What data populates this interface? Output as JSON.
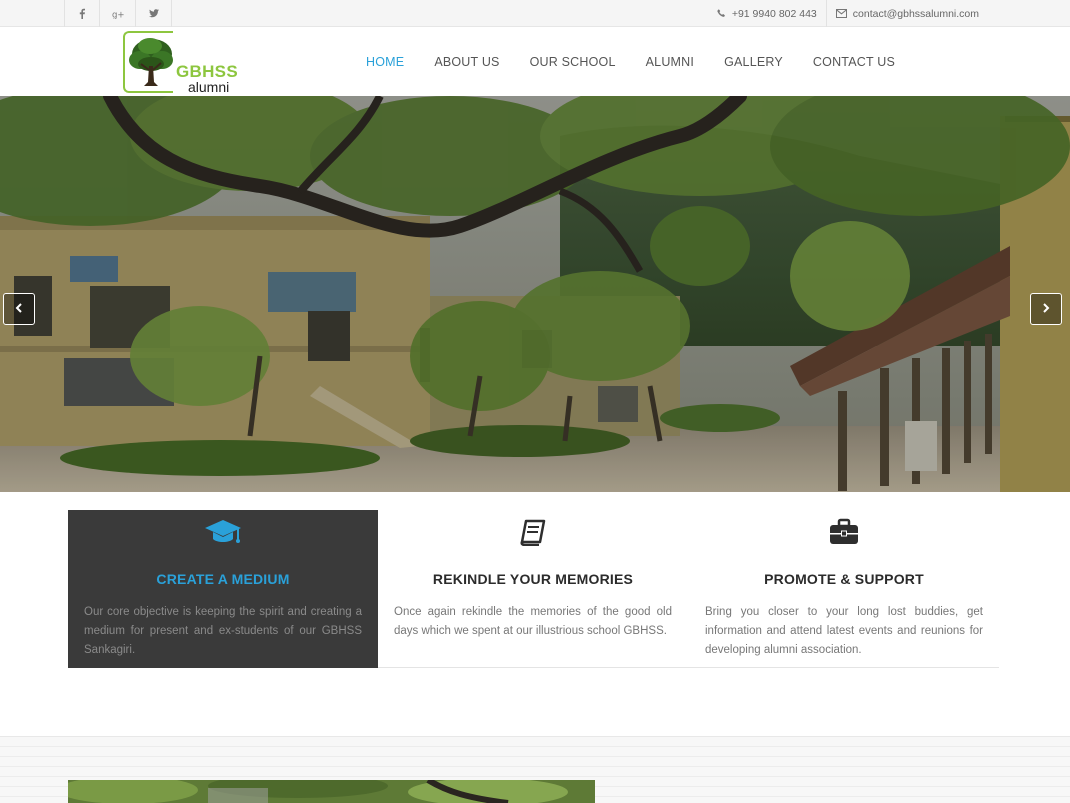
{
  "topbar": {
    "social": [
      {
        "name": "facebook-icon",
        "glyph": "f"
      },
      {
        "name": "google-plus-icon",
        "glyph": "g+"
      },
      {
        "name": "twitter-icon",
        "glyph": "t"
      }
    ],
    "phone": "+91 9940 802 443",
    "email": "contact@gbhssalumni.com"
  },
  "logo": {
    "title": "GBHSS",
    "subtitle": "alumni"
  },
  "nav": {
    "items": [
      "HOME",
      "ABOUT US",
      "OUR SCHOOL",
      "ALUMNI",
      "GALLERY",
      "CONTACT US"
    ],
    "active": "HOME"
  },
  "features": [
    {
      "icon": "graduation-cap-icon",
      "title": "CREATE A MEDIUM",
      "text": "Our core objective is keeping the spirit and creating a medium for present and ex-students of our GBHSS Sankagiri."
    },
    {
      "icon": "book-icon",
      "title": "REKINDLE YOUR MEMORIES",
      "text": "Once again rekindle the memories of the good old days which we spent at our illustrious school GBHSS."
    },
    {
      "icon": "briefcase-icon",
      "title": "PROMOTE & SUPPORT",
      "text": "Bring you closer to your long lost buddies, get information and attend latest events and reunions for developing alumni association."
    }
  ],
  "colors": {
    "accent": "#2aa1d9",
    "logo_green": "#8dc63f",
    "dark_panel": "#3a3a3a"
  }
}
